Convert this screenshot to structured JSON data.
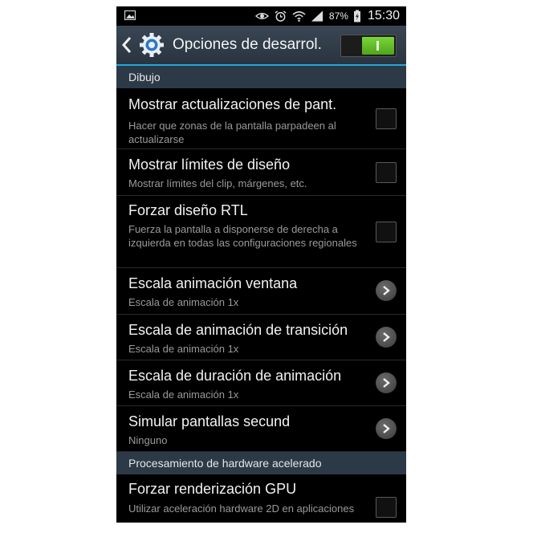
{
  "status_bar": {
    "battery_percent": "87%",
    "time": "15:30",
    "icons": [
      "image-icon",
      "eye-icon",
      "alarm-icon",
      "wifi-icon",
      "signal-icon",
      "battery-charging-icon"
    ]
  },
  "action_bar": {
    "title": "Opciones de desarrol.",
    "master_switch_on": true,
    "accent": "#6cc52e"
  },
  "sections": [
    {
      "header": "Dibujo",
      "items": [
        {
          "title": "Mostrar actualizaciones de pant.",
          "summary": "Hacer que zonas de la pantalla parpadeen al actualizarse",
          "control": "checkbox",
          "checked": false
        },
        {
          "title": "Mostrar límites de diseño",
          "summary": "Mostrar límites del clip, márgenes, etc.",
          "control": "checkbox",
          "checked": false
        },
        {
          "title": "Forzar diseño RTL",
          "summary": "Fuerza la pantalla a disponerse de derecha a izquierda en todas las configuraciones regionales",
          "control": "checkbox",
          "checked": false
        },
        {
          "title": "Escala animación ventana",
          "summary": "Escala de animación 1x",
          "control": "chevron"
        },
        {
          "title": "Escala de animación de transición",
          "summary": "Escala de animación 1x",
          "control": "chevron"
        },
        {
          "title": "Escala de duración de animación",
          "summary": "Escala de animación 1x",
          "control": "chevron"
        },
        {
          "title": "Simular pantallas secund",
          "summary": "Ninguno",
          "control": "chevron"
        }
      ]
    },
    {
      "header": "Procesamiento de hardware acelerado",
      "items": [
        {
          "title": "Forzar renderización GPU",
          "summary": "Utilizar aceleración hardware 2D en aplicaciones",
          "control": "checkbox",
          "checked": false
        }
      ]
    }
  ]
}
